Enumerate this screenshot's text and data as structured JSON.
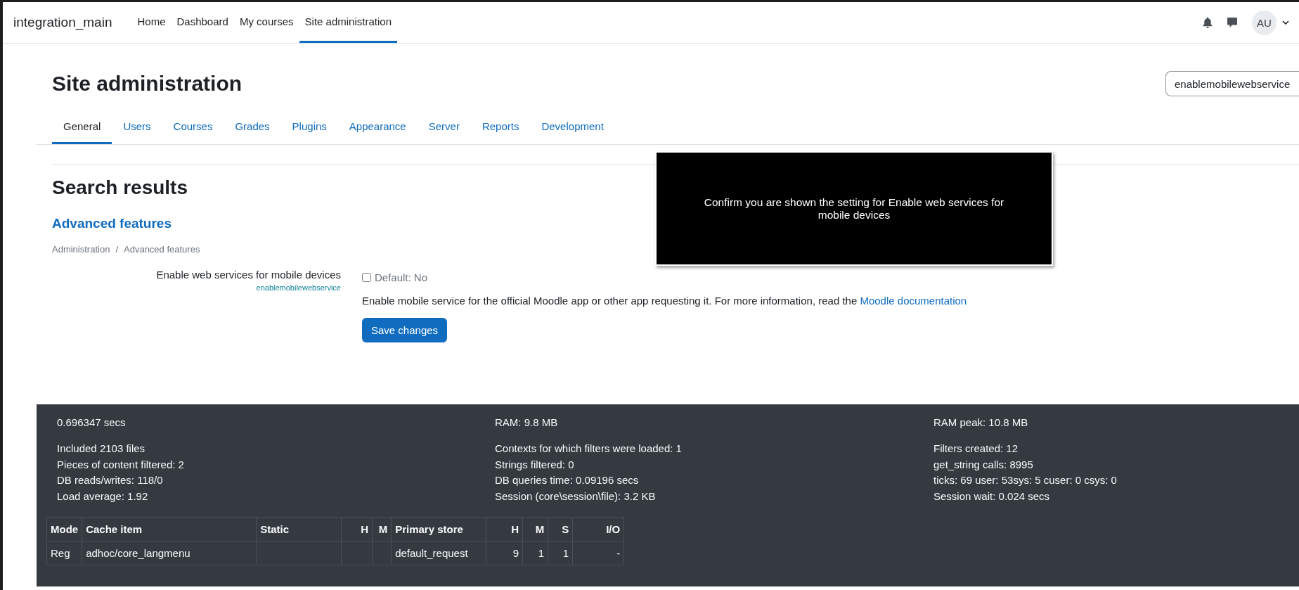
{
  "navbar": {
    "brand": "integration_main",
    "items": [
      {
        "label": "Home",
        "selected": false
      },
      {
        "label": "Dashboard",
        "selected": false
      },
      {
        "label": "My courses",
        "selected": false
      },
      {
        "label": "Site administration",
        "selected": true
      }
    ],
    "user_initials": "AU"
  },
  "page_title": "Site administration",
  "search": {
    "value": "enablemobilewebservice"
  },
  "tabs": [
    {
      "label": "General",
      "selected": true
    },
    {
      "label": "Users",
      "selected": false
    },
    {
      "label": "Courses",
      "selected": false
    },
    {
      "label": "Grades",
      "selected": false
    },
    {
      "label": "Plugins",
      "selected": false
    },
    {
      "label": "Appearance",
      "selected": false
    },
    {
      "label": "Server",
      "selected": false
    },
    {
      "label": "Reports",
      "selected": false
    },
    {
      "label": "Development",
      "selected": false
    }
  ],
  "section_title": "Search results",
  "category_link": "Advanced features",
  "breadcrumb": [
    "Administration",
    "Advanced features"
  ],
  "breadcrumb_separator": "/",
  "setting": {
    "label": "Enable web services for mobile devices",
    "name": "enablemobilewebservice",
    "checked": false,
    "default": "Default: No",
    "description": "Enable mobile service for the official Moodle app or other app requesting it. For more information, read the ",
    "link": "Moodle documentation"
  },
  "save_button": "Save changes",
  "overlay": {
    "text": "Confirm you are shown the setting for Enable web services for mobile devices"
  },
  "performance": {
    "columns": [
      {
        "heading": "0.696347 secs",
        "lines": [
          "Included 2103 files",
          "Pieces of content filtered: 2",
          "DB reads/writes: 118/0",
          "Load average: 1.92"
        ]
      },
      {
        "heading": "RAM: 9.8 MB",
        "lines": [
          "Contexts for which filters were loaded: 1",
          "Strings filtered: 0",
          "DB queries time: 0.09196 secs",
          "Session (core\\session\\file): 3.2 KB"
        ]
      },
      {
        "heading": "RAM peak: 10.8 MB",
        "lines": [
          "Filters created: 12",
          "get_string calls: 8995",
          "ticks: 69 user: 53sys: 5 cuser: 0 csys: 0",
          "Session wait: 0.024 secs"
        ]
      }
    ]
  },
  "cache_table": {
    "columns": [
      "Mode",
      "Cache item",
      "Static",
      "H",
      "M",
      "Primary store",
      "H",
      "M",
      "S",
      "I/O"
    ],
    "rows": [
      [
        "Reg",
        "adhoc/core_langmenu",
        "",
        "",
        "",
        "default_request",
        "9",
        "1",
        "1",
        "-"
      ]
    ]
  }
}
